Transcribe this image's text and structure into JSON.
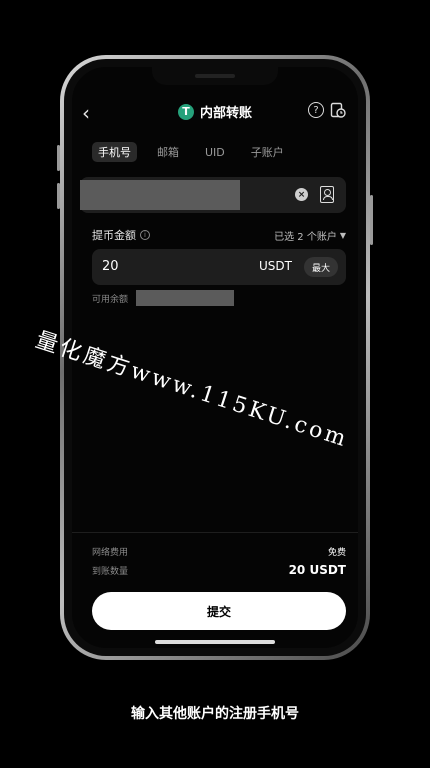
{
  "header": {
    "back_icon": "chevron-left-icon",
    "token_icon_letter": "T",
    "title": "内部转账",
    "help_icon": "question-icon",
    "history_icon": "history-icon"
  },
  "tabs": [
    {
      "label": "手机号",
      "active": true
    },
    {
      "label": "邮箱",
      "active": false
    },
    {
      "label": "UID",
      "active": false
    },
    {
      "label": "子账户",
      "active": false
    }
  ],
  "recipient": {
    "clear_icon": "clear-icon",
    "contacts_icon": "contacts-icon"
  },
  "amount": {
    "label": "提币金额",
    "info_icon": "info-icon",
    "selected_accounts": "已选 2 个账户",
    "value": "20",
    "currency": "USDT",
    "max_label": "最大",
    "balance_label": "可用余额"
  },
  "watermark": "量化魔方www.115KU.com",
  "summary": {
    "fee_label": "网络费用",
    "fee_value": "免费",
    "received_label": "到账数量",
    "received_value": "20 USDT"
  },
  "submit_label": "提交",
  "caption": "输入其他账户的注册手机号",
  "colors": {
    "background": "#000000",
    "accent_tether": "#26a17b",
    "input_bg": "#1e1e1e",
    "button_bg": "#ffffff"
  }
}
